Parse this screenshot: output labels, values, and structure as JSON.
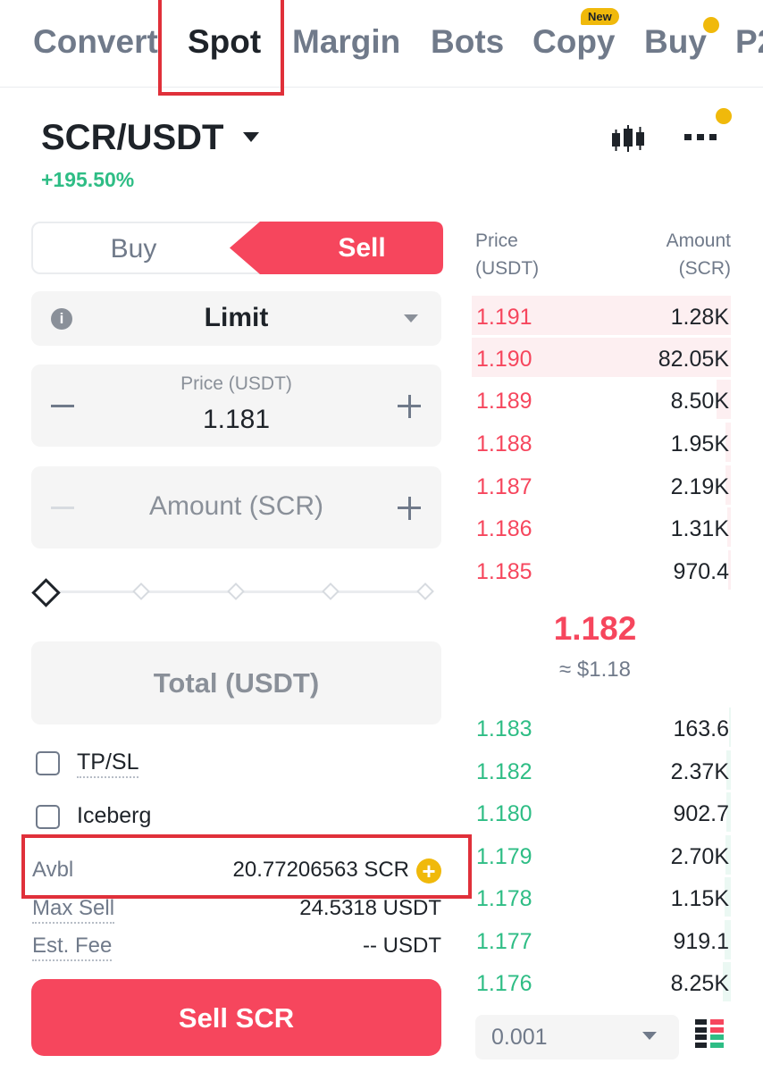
{
  "tabs": [
    {
      "label": "Convert",
      "active": false
    },
    {
      "label": "Spot",
      "active": true
    },
    {
      "label": "Margin",
      "active": false
    },
    {
      "label": "Bots",
      "active": false
    },
    {
      "label": "Copy",
      "active": false,
      "badge": "New"
    },
    {
      "label": "Buy",
      "active": false
    },
    {
      "label": "P2",
      "active": false
    }
  ],
  "pair": {
    "symbol": "SCR/USDT",
    "change": "+195.50%"
  },
  "header_icons": [
    "candlestick-chart-icon",
    "more-options-icon"
  ],
  "order_side": {
    "buy_label": "Buy",
    "sell_label": "Sell",
    "selected": "Sell"
  },
  "order_type": {
    "label": "Limit"
  },
  "price_input": {
    "caption": "Price (USDT)",
    "value": "1.181"
  },
  "amount_input": {
    "placeholder": "Amount (SCR)"
  },
  "slider": {
    "percent": 0
  },
  "total_input": {
    "placeholder": "Total (USDT)"
  },
  "options": {
    "tpsl_label": "TP/SL",
    "iceberg_label": "Iceberg"
  },
  "balances": {
    "avbl_label": "Avbl",
    "avbl_value": "20.77206563 SCR",
    "max_sell_label": "Max Sell",
    "max_sell_value": "24.5318 USDT",
    "fee_label": "Est. Fee",
    "fee_value": "-- USDT"
  },
  "submit_label": "Sell SCR",
  "orderbook": {
    "price_header_1": "Price",
    "price_header_2": "(USDT)",
    "amount_header_1": "Amount",
    "amount_header_2": "(SCR)",
    "asks": [
      {
        "price": "1.191",
        "amount": "1.28K"
      },
      {
        "price": "1.190",
        "amount": "82.05K"
      },
      {
        "price": "1.189",
        "amount": "8.50K"
      },
      {
        "price": "1.188",
        "amount": "1.95K"
      },
      {
        "price": "1.187",
        "amount": "2.19K"
      },
      {
        "price": "1.186",
        "amount": "1.31K"
      },
      {
        "price": "1.185",
        "amount": "970.4"
      }
    ],
    "last_price": "1.182",
    "last_price_usd": "≈ $1.18",
    "bids": [
      {
        "price": "1.183",
        "amount": "163.6"
      },
      {
        "price": "1.182",
        "amount": "2.37K"
      },
      {
        "price": "1.180",
        "amount": "902.7"
      },
      {
        "price": "1.179",
        "amount": "2.70K"
      },
      {
        "price": "1.178",
        "amount": "1.15K"
      },
      {
        "price": "1.177",
        "amount": "919.1"
      },
      {
        "price": "1.176",
        "amount": "8.25K"
      }
    ],
    "precision": "0.001"
  },
  "colors": {
    "sell": "#f6465d",
    "buy": "#2ebd85",
    "accent": "#f0b90b",
    "highlight": "#e0303a"
  }
}
